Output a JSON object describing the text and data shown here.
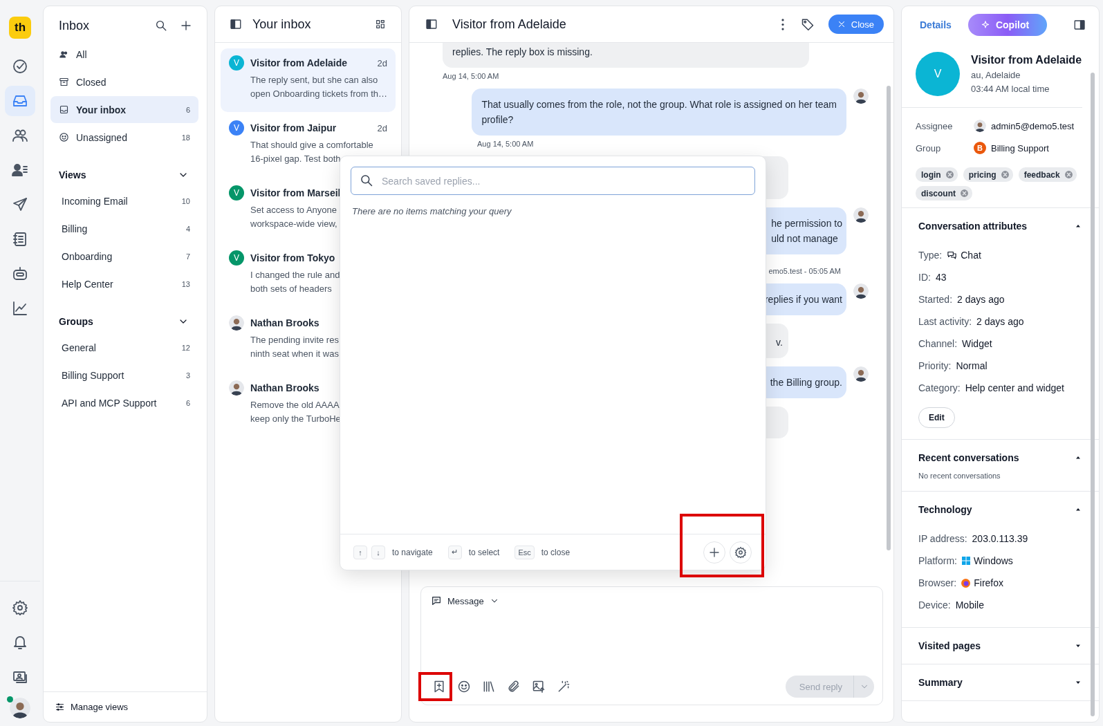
{
  "rail": {
    "logo": "th",
    "items": [
      {
        "selected": false
      },
      {
        "selected": true
      },
      {
        "selected": false
      },
      {
        "selected": false
      },
      {
        "selected": false
      },
      {
        "selected": false
      },
      {
        "selected": false
      },
      {
        "selected": false
      }
    ],
    "user_online": true
  },
  "sidebar": {
    "title": "Inbox",
    "items": [
      {
        "label": "All",
        "selected": false
      },
      {
        "label": "Closed",
        "selected": false
      },
      {
        "label": "Your inbox",
        "count": "6",
        "selected": true
      },
      {
        "label": "Unassigned",
        "count": "18",
        "selected": false
      }
    ],
    "sections": [
      {
        "title": "Views",
        "expanded": true,
        "items": [
          {
            "label": "Incoming Email",
            "count": "10"
          },
          {
            "label": "Billing",
            "count": "4"
          },
          {
            "label": "Onboarding",
            "count": "7"
          },
          {
            "label": "Help Center",
            "count": "13"
          }
        ]
      },
      {
        "title": "Groups",
        "expanded": true,
        "items": [
          {
            "label": "General",
            "count": "12"
          },
          {
            "label": "Billing Support",
            "count": "3"
          },
          {
            "label": "API and MCP Support",
            "count": "6"
          }
        ]
      }
    ],
    "footer": "Manage views"
  },
  "conversations": {
    "title": "Your inbox",
    "items": [
      {
        "kind": "letter",
        "avatar": "V",
        "color": "#0bb5d4",
        "name": "Visitor from Adelaide",
        "time": "2d",
        "preview": [
          "The reply sent, but she can also",
          "open Onboarding tickets from th…"
        ],
        "selected": true
      },
      {
        "kind": "letter",
        "avatar": "V",
        "color": "#3b82f6",
        "name": "Visitor from Jaipur",
        "time": "2d",
        "preview": [
          "That should give a comfortable",
          "16-pixel gap. Test both"
        ],
        "selected": false
      },
      {
        "kind": "letter",
        "avatar": "V",
        "color": "#059669",
        "name": "Visitor from Marseil",
        "preview": [
          "Set access to Anyone",
          "workspace-wide view,"
        ],
        "selected": false
      },
      {
        "kind": "letter",
        "avatar": "V",
        "color": "#059669",
        "name": "Visitor from Tokyo",
        "preview": [
          "I changed the rule and",
          "both sets of headers"
        ],
        "selected": false
      },
      {
        "kind": "photo",
        "name": "Nathan Brooks",
        "preview": [
          "The pending invite res",
          "ninth seat when it was"
        ],
        "selected": false
      },
      {
        "kind": "photo",
        "name": "Nathan Brooks",
        "preview": [
          "Remove the old AAAA",
          "keep only the TurboHe"
        ],
        "selected": false
      }
    ]
  },
  "chat": {
    "title": "Visitor from Adelaide",
    "close": "Close",
    "messages": [
      {
        "kind": "visitor",
        "lines": [
          "replies. The reply box is missing."
        ],
        "time": "Aug 14, 5:00 AM"
      },
      {
        "kind": "agent",
        "lines": [
          "That usually comes from the role, not the group. What role is assigned on her team",
          "profile?"
        ],
        "time": "Aug 14, 5:00 AM"
      },
      {
        "kind": "visitor",
        "covered": true
      },
      {
        "kind": "agent",
        "covered": true,
        "lines": [
          "he permission to",
          "uld not manage"
        ],
        "time": "emo5.test - 05:05 AM"
      },
      {
        "kind": "agent",
        "covered": true,
        "lines": [
          "replies if you want"
        ]
      },
      {
        "kind": "visitor",
        "covered": true,
        "lines": [
          "v."
        ]
      },
      {
        "kind": "agent",
        "covered": true,
        "lines": [
          "the Billing group."
        ]
      },
      {
        "kind": "visitor",
        "covered": true
      }
    ],
    "composer": {
      "mode": "Message",
      "tools": [
        {
          "highlighted": true
        },
        {
          "highlighted": false
        },
        {
          "highlighted": false
        },
        {
          "highlighted": false
        },
        {
          "highlighted": false
        },
        {
          "highlighted": false
        }
      ],
      "send": "Send reply",
      "send_disabled": true
    }
  },
  "saved_replies": {
    "placeholder": "Search saved replies...",
    "empty": "There are no items matching your query",
    "hints": [
      {
        "keys": [
          "↑",
          "↓"
        ],
        "text": "to navigate"
      },
      {
        "keys": [
          "↵"
        ],
        "text": "to select"
      },
      {
        "keys": [
          "Esc"
        ],
        "text": "to close"
      }
    ],
    "actions_highlighted": true
  },
  "details": {
    "tabs": [
      {
        "label": "Details",
        "kind": "plain",
        "selected": true
      },
      {
        "label": "Copilot",
        "kind": "ai",
        "selected": false
      }
    ],
    "contact": {
      "avatar": "V",
      "name": "Visitor from Adelaide",
      "location": "au, Adelaide",
      "local_time": "03:44 AM local time"
    },
    "fields": [
      {
        "label": "Assignee",
        "kind": "person",
        "value": "admin5@demo5.test"
      },
      {
        "label": "Group",
        "kind": "badge",
        "badge": "B",
        "color": "#ea580c",
        "value": "Billing Support"
      }
    ],
    "tags": [
      "login",
      "pricing",
      "feedback",
      "discount"
    ],
    "sections": [
      {
        "title": "Conversation attributes",
        "expanded": true,
        "rows": [
          {
            "label": "Type:",
            "kind": "chat",
            "value": "Chat"
          },
          {
            "label": "ID:",
            "value": "43"
          },
          {
            "label": "Started:",
            "value": "2 days ago"
          },
          {
            "label": "Last activity:",
            "value": "2 days ago"
          },
          {
            "label": "Channel:",
            "value": "Widget"
          },
          {
            "label": "Priority:",
            "value": "Normal"
          },
          {
            "label": "Category:",
            "value": "Help center and widget"
          }
        ],
        "button": "Edit"
      },
      {
        "title": "Recent conversations",
        "expanded": true,
        "note": "No recent conversations"
      },
      {
        "title": "Technology",
        "expanded": true,
        "rows": [
          {
            "label": "IP address:",
            "value": "203.0.113.39"
          },
          {
            "label": "Platform:",
            "kind": "windows",
            "value": "Windows"
          },
          {
            "label": "Browser:",
            "kind": "firefox",
            "value": "Firefox"
          },
          {
            "label": "Device:",
            "value": "Mobile"
          }
        ]
      },
      {
        "title": "Visited pages",
        "expanded": false
      },
      {
        "title": "Summary",
        "expanded": false
      }
    ]
  }
}
